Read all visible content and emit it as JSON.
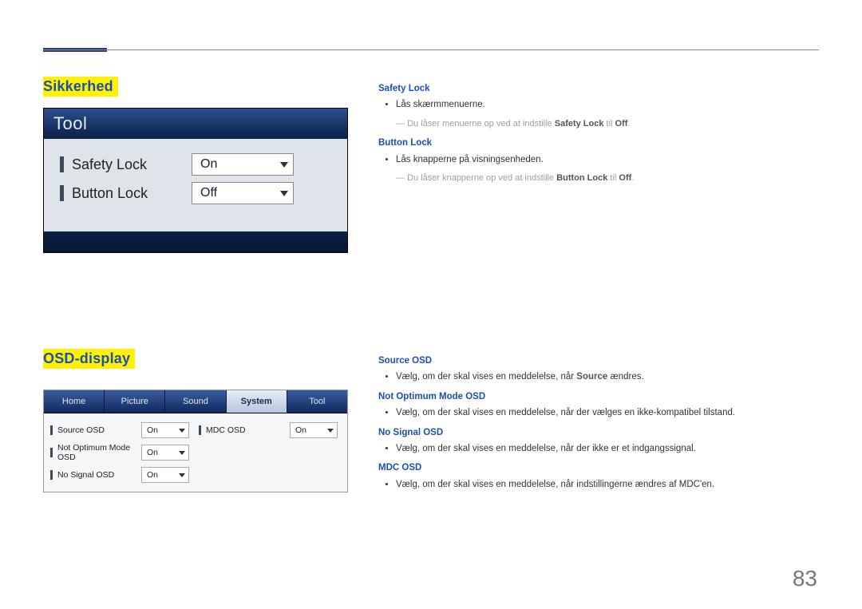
{
  "page_number": "83",
  "section1": {
    "title": "Sikkerhed",
    "tool_header": "Tool",
    "rows": [
      {
        "label": "Safety Lock",
        "value": "On"
      },
      {
        "label": "Button Lock",
        "value": "Off"
      }
    ],
    "text": {
      "safety_lock_head": "Safety Lock",
      "safety_lock_bullet": "Lås skærmmenuerne.",
      "safety_lock_note_pre": "Du låser menuerne op ved at indstille ",
      "safety_lock_note_bold": "Safety Lock",
      "safety_lock_note_mid": " til ",
      "safety_lock_note_off": "Off",
      "safety_lock_note_end": ".",
      "button_lock_head": "Button Lock",
      "button_lock_bullet": "Lås knapperne på visningsenheden.",
      "button_lock_note_pre": "Du låser knapperne op ved at indstille ",
      "button_lock_note_bold": "Button Lock",
      "button_lock_note_mid": " til ",
      "button_lock_note_off": "Off",
      "button_lock_note_end": "."
    }
  },
  "section2": {
    "title": "OSD-display",
    "tabs": [
      "Home",
      "Picture",
      "Sound",
      "System",
      "Tool"
    ],
    "active_tab_index": 3,
    "left_rows": [
      {
        "label": "Source OSD",
        "value": "On"
      },
      {
        "label": "Not Optimum Mode OSD",
        "value": "On"
      },
      {
        "label": "No Signal OSD",
        "value": "On"
      }
    ],
    "right_rows": [
      {
        "label": "MDC OSD",
        "value": "On"
      }
    ],
    "text": {
      "source_head": "Source OSD",
      "source_bullet_pre": "Vælg, om der skal vises en meddelelse, når ",
      "source_bullet_bold": "Source",
      "source_bullet_post": " ændres.",
      "notopt_head": "Not Optimum Mode OSD",
      "notopt_bullet": "Vælg, om der skal vises en meddelelse, når der vælges en ikke-kompatibel tilstand.",
      "nosignal_head": "No Signal OSD",
      "nosignal_bullet": "Vælg, om der skal vises en meddelelse, når der ikke er et indgangssignal.",
      "mdc_head": "MDC OSD",
      "mdc_bullet": "Vælg, om der skal vises en meddelelse, når indstillingerne ændres af MDC'en."
    }
  }
}
